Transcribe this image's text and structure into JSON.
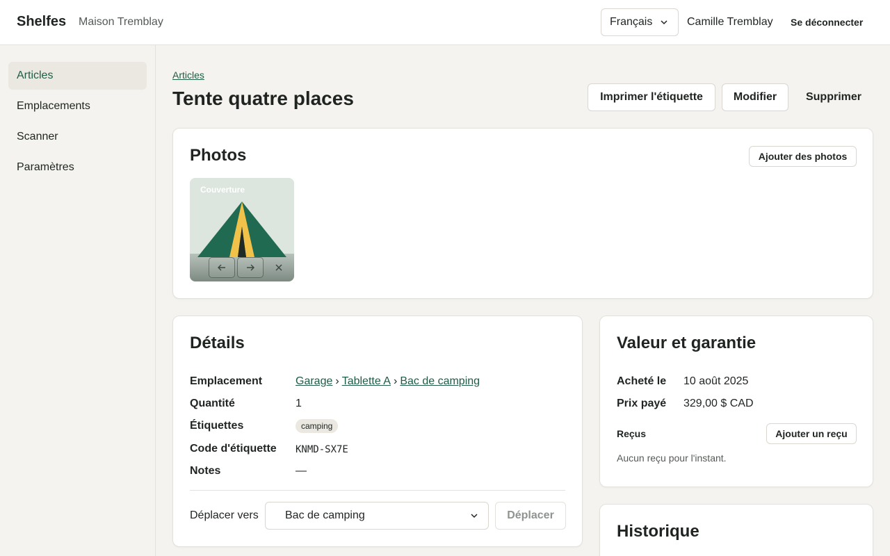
{
  "header": {
    "brand": "Shelfes",
    "household": "Maison Tremblay",
    "language": "Français",
    "user": "Camille Tremblay",
    "logout": "Se déconnecter"
  },
  "sidebar": {
    "items": [
      {
        "label": "Articles",
        "active": true
      },
      {
        "label": "Emplacements",
        "active": false
      },
      {
        "label": "Scanner",
        "active": false
      },
      {
        "label": "Paramètres",
        "active": false
      }
    ]
  },
  "page": {
    "breadcrumb": "Articles",
    "title": "Tente quatre places",
    "actions": {
      "print": "Imprimer l'étiquette",
      "edit": "Modifier",
      "delete": "Supprimer"
    }
  },
  "photos": {
    "title": "Photos",
    "add_button": "Ajouter des photos",
    "cover_label": "Couverture"
  },
  "details": {
    "title": "Détails",
    "location_label": "Emplacement",
    "location_path": [
      "Garage",
      "Tablette A",
      "Bac de camping"
    ],
    "quantity_label": "Quantité",
    "quantity": "1",
    "tags_label": "Étiquettes",
    "tags": [
      "camping"
    ],
    "code_label": "Code d'étiquette",
    "code": "KNMD-SX7E",
    "notes_label": "Notes",
    "notes": "—",
    "move_label": "Déplacer vers",
    "move_selected": "Bac de camping",
    "move_button": "Déplacer"
  },
  "value": {
    "title": "Valeur et garantie",
    "purchased_label": "Acheté le",
    "purchased": "10 août 2025",
    "price_label": "Prix payé",
    "price": "329,00 $ CAD",
    "receipts_label": "Reçus",
    "add_receipt": "Ajouter un reçu",
    "empty_receipts": "Aucun reçu pour l'instant."
  },
  "history": {
    "title": "Historique"
  },
  "colors": {
    "accent": "#1f5c45",
    "tent": "#1f6a50",
    "tent_stripe": "#f0c24a"
  }
}
